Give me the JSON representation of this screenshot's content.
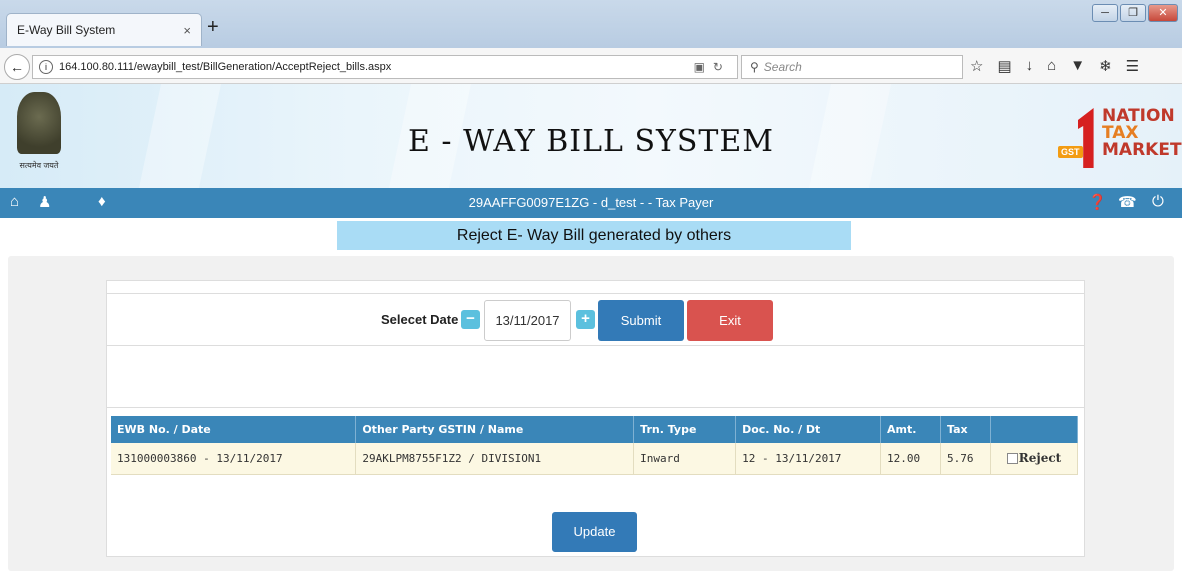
{
  "browser": {
    "tab_title": "E-Way Bill System",
    "tab_close": "×",
    "new_tab": "+",
    "url": "164.100.80.111/ewaybill_test/BillGeneration/AcceptReject_bills.aspx",
    "search_placeholder": "Search",
    "window_buttons": [
      "minimize",
      "maximize",
      "close"
    ],
    "toolbar_icons": [
      "bookmark-star-icon",
      "reading-list-icon",
      "download-icon",
      "home-icon",
      "pocket-icon",
      "extension-icon",
      "menu-icon"
    ]
  },
  "header": {
    "title": "E - WAY BILL SYSTEM",
    "emblem_motto": "सत्यमेव जयते",
    "logo_words": [
      "NATION",
      "TAX",
      "MARKET"
    ],
    "logo_badge": "GST"
  },
  "nav": {
    "user_line": "29AAFFG0097E1ZG - d_test - - Tax Payer",
    "left_icons": [
      "home-icon",
      "user-icon",
      "bell-icon"
    ],
    "right_icons": [
      "help-icon",
      "phone-icon",
      "power-icon"
    ]
  },
  "page": {
    "title": "Reject E- Way Bill generated by others"
  },
  "form": {
    "date_label": "Selecet Date",
    "date_value": "13/11/2017",
    "minus": "−",
    "plus": "+",
    "submit_label": "Submit",
    "exit_label": "Exit",
    "update_label": "Update"
  },
  "table": {
    "columns": [
      "EWB No. / Date",
      "Other Party GSTIN / Name",
      "Trn. Type",
      "Doc. No. / Dt",
      "Amt.",
      "Tax",
      ""
    ],
    "rows": [
      {
        "ewb": "131000003860 - 13/11/2017",
        "party": "29AKLPM8755F1Z2 / DIVISION1",
        "trn_type": "Inward",
        "doc": "12 - 13/11/2017",
        "amt": "12.00",
        "tax": "5.76",
        "reject_label": "Reject",
        "reject_checked": false
      }
    ]
  }
}
